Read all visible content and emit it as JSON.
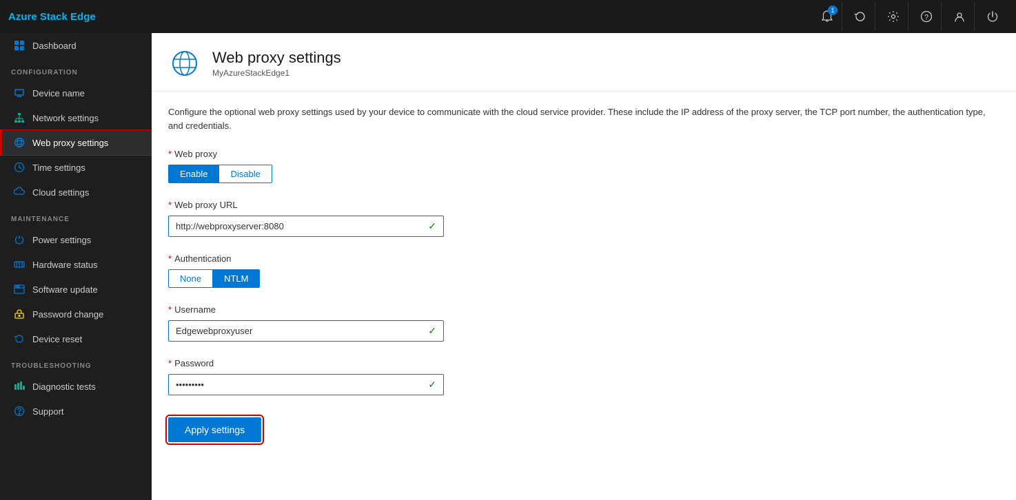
{
  "app": {
    "brand": "Azure Stack Edge"
  },
  "topbar": {
    "notification_count": "1",
    "icons": [
      "bell",
      "refresh",
      "gear",
      "help",
      "user",
      "power"
    ]
  },
  "sidebar": {
    "dashboard_label": "Dashboard",
    "sections": [
      {
        "label": "CONFIGURATION",
        "items": [
          {
            "id": "device-name",
            "label": "Device name",
            "icon": "device"
          },
          {
            "id": "network-settings",
            "label": "Network settings",
            "icon": "network"
          },
          {
            "id": "web-proxy-settings",
            "label": "Web proxy settings",
            "icon": "webproxy",
            "active": true
          },
          {
            "id": "time-settings",
            "label": "Time settings",
            "icon": "time"
          },
          {
            "id": "cloud-settings",
            "label": "Cloud settings",
            "icon": "cloud"
          }
        ]
      },
      {
        "label": "MAINTENANCE",
        "items": [
          {
            "id": "power-settings",
            "label": "Power settings",
            "icon": "power"
          },
          {
            "id": "hardware-status",
            "label": "Hardware status",
            "icon": "hardware"
          },
          {
            "id": "software-update",
            "label": "Software update",
            "icon": "software"
          },
          {
            "id": "password-change",
            "label": "Password change",
            "icon": "password"
          },
          {
            "id": "device-reset",
            "label": "Device reset",
            "icon": "reset"
          }
        ]
      },
      {
        "label": "TROUBLESHOOTING",
        "items": [
          {
            "id": "diagnostic-tests",
            "label": "Diagnostic tests",
            "icon": "diag"
          },
          {
            "id": "support",
            "label": "Support",
            "icon": "support"
          }
        ]
      }
    ]
  },
  "page": {
    "title": "Web proxy settings",
    "subtitle": "MyAzureStackEdge1",
    "description": "Configure the optional web proxy settings used by your device to communicate with the cloud service provider. These include the IP address of the proxy server, the TCP port number, the authentication type, and credentials.",
    "web_proxy_label": "Web proxy",
    "enable_label": "Enable",
    "disable_label": "Disable",
    "url_label": "Web proxy URL",
    "url_value": "http://webproxyserver:8080",
    "auth_label": "Authentication",
    "auth_none_label": "None",
    "auth_ntlm_label": "NTLM",
    "username_label": "Username",
    "username_value": "Edgewebproxyuser",
    "password_label": "Password",
    "password_value": "••••••••",
    "apply_label": "Apply settings"
  }
}
